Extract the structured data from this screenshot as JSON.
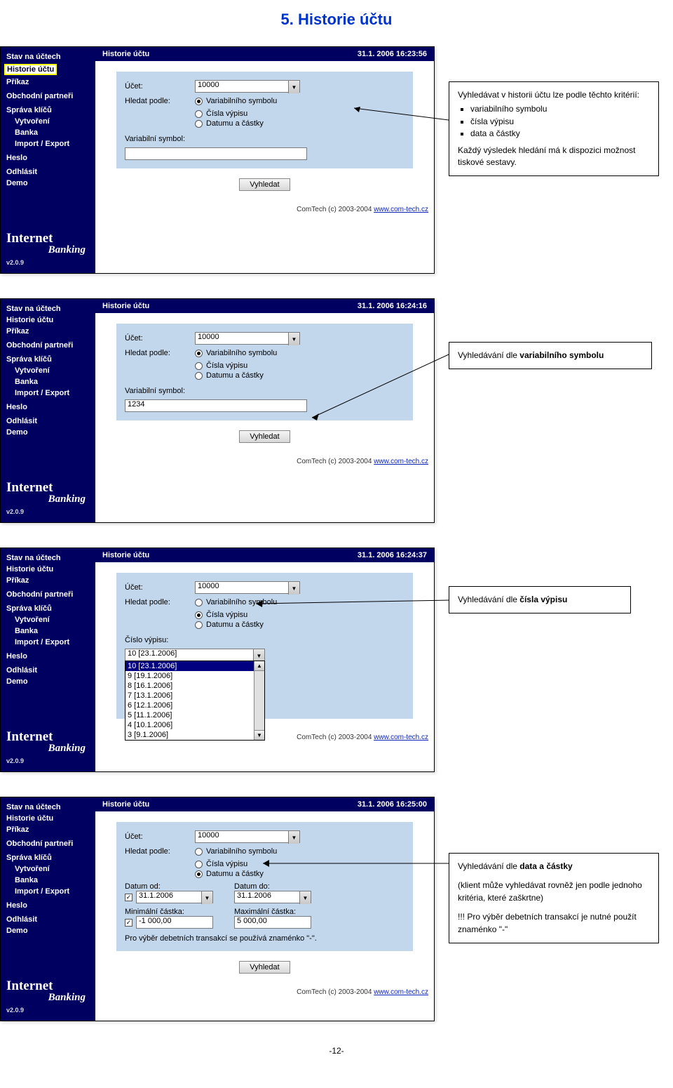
{
  "page_title": "5. Historie účtu",
  "page_number": "-12-",
  "sidebar": {
    "items": [
      "Stav na účtech",
      "Historie účtu",
      "Příkaz",
      "Obchodní partneři",
      "Správa klíčů",
      "Vytvoření",
      "Banka",
      "Import / Export",
      "Heslo",
      "Odhlásit",
      "Demo"
    ],
    "logo1": "Internet",
    "logo2": "Banking",
    "version": "v2.0.9"
  },
  "footer": {
    "text": "ComTech (c) 2003-2004 ",
    "link": "www.com-tech.cz"
  },
  "shots": [
    {
      "title": "Historie účtu",
      "timestamp": "31.1. 2006 16:23:56",
      "account_label": "Účet:",
      "account_value": "10000",
      "search_label": "Hledat podle:",
      "options": [
        "Variabilního symbolu",
        "Čísla výpisu",
        "Datumu a částky"
      ],
      "selected": 0,
      "vs_label": "Variabilní symbol:",
      "vs_value": "",
      "button": "Vyhledat",
      "sidebar_selected": 1
    },
    {
      "title": "Historie účtu",
      "timestamp": "31.1. 2006 16:24:16",
      "account_label": "Účet:",
      "account_value": "10000",
      "search_label": "Hledat podle:",
      "options": [
        "Variabilního symbolu",
        "Čísla výpisu",
        "Datumu a částky"
      ],
      "selected": 0,
      "vs_label": "Variabilní symbol:",
      "vs_value": "1234",
      "button": "Vyhledat",
      "sidebar_selected": -1
    },
    {
      "title": "Historie účtu",
      "timestamp": "31.1. 2006 16:24:37",
      "account_label": "Účet:",
      "account_value": "10000",
      "search_label": "Hledat podle:",
      "options": [
        "Variabilního symbolu",
        "Čísla výpisu",
        "Datumu a částky"
      ],
      "selected": 1,
      "cv_label": "Číslo výpisu:",
      "cv_value": "10 [23.1.2006]",
      "dropdown": [
        "10 [23.1.2006]",
        "9 [19.1.2006]",
        "8 [16.1.2006]",
        "7 [13.1.2006]",
        "6 [12.1.2006]",
        "5 [11.1.2006]",
        "4 [10.1.2006]",
        "3 [9.1.2006]"
      ],
      "button": "Vyhledat",
      "sidebar_selected": -1
    },
    {
      "title": "Historie účtu",
      "timestamp": "31.1. 2006 16:25:00",
      "account_label": "Účet:",
      "account_value": "10000",
      "search_label": "Hledat podle:",
      "options": [
        "Variabilního symbolu",
        "Čísla výpisu",
        "Datumu a částky"
      ],
      "selected": 2,
      "date_from_label": "Datum od:",
      "date_from": "31.1.2006",
      "date_to_label": "Datum do:",
      "date_to": "31.1.2006",
      "min_label": "Minimální částka:",
      "min_value": "-1 000,00",
      "max_label": "Maximální částka:",
      "max_value": "5 000,00",
      "note": "Pro výběr debetních transakcí se používá znaménko \"-\".",
      "button": "Vyhledat",
      "sidebar_selected": -1
    }
  ],
  "callouts": [
    {
      "lines": [
        "Vyhledávat v historii účtu lze podle těchto kritérií:"
      ],
      "bullets": [
        "variabilního symbolu",
        "čísla výpisu",
        "data a částky"
      ],
      "after": "Každý výsledek hledání má k dispozici možnost tiskové sestavy."
    },
    {
      "html": "Vyhledávání dle <b>variabilního symbolu</b>"
    },
    {
      "html": "Vyhledávání dle <b>čísla výpisu</b>"
    },
    {
      "html_lines": [
        "Vyhledávání dle <b>data a částky</b>",
        "",
        "(klient může vyhledávat rovněž jen podle jednoho kritéria, které zaškrtne)",
        "",
        "!!! Pro výběr debetních transakcí je nutné použít znaménko \"-\""
      ]
    }
  ]
}
